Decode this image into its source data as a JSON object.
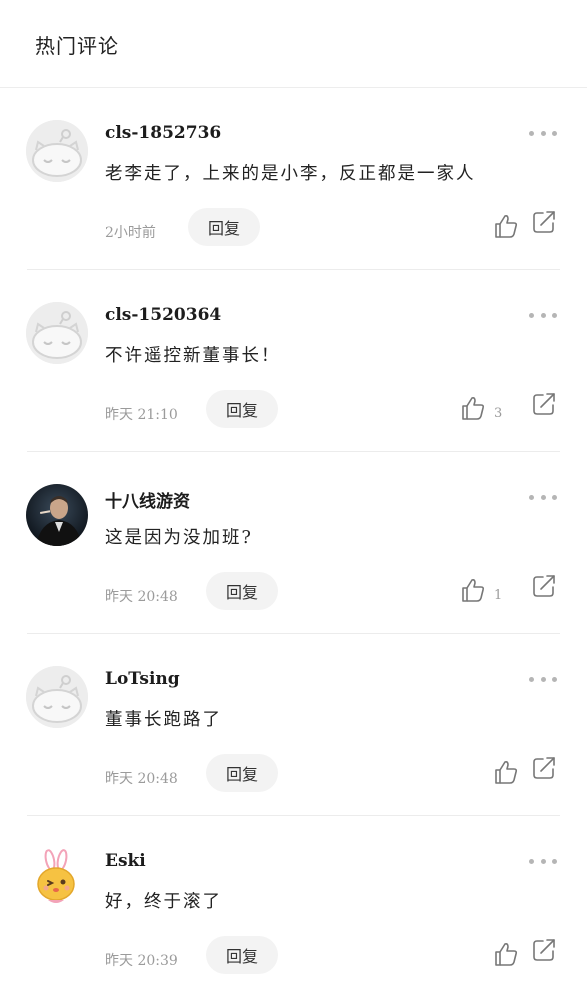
{
  "header": {
    "title": "热门评论"
  },
  "comments": [
    {
      "username": "cls-1852736",
      "text": "老李走了，上来的是小李，反正都是一家人",
      "time": "2小时前",
      "reply_label": "回复",
      "likes": "",
      "avatar": "default-robot-avatar"
    },
    {
      "username": "cls-1520364",
      "text": "不许遥控新董事长！",
      "time": "昨天 21:10",
      "reply_label": "回复",
      "likes": "3",
      "avatar": "default-robot-avatar"
    },
    {
      "username": "十八线游资",
      "text": "这是因为没加班?",
      "time": "昨天 20:48",
      "reply_label": "回复",
      "likes": "1",
      "avatar": "dark-portrait-avatar"
    },
    {
      "username": "LoTsing",
      "text": "董事长跑路了",
      "time": "昨天 20:48",
      "reply_label": "回复",
      "likes": "",
      "avatar": "default-robot-avatar"
    },
    {
      "username": "Eski",
      "text": "好，终于滚了",
      "time": "昨天 20:39",
      "reply_label": "回复",
      "likes": "",
      "avatar": "cartoon-bunny-avatar"
    }
  ],
  "icons": {
    "more": "more-dots-icon",
    "like": "thumbs-up-icon",
    "share": "share-icon"
  },
  "colors": {
    "muted_text": "#9b9b9b",
    "reply_bg": "#f3f3f3",
    "divider": "#ececec"
  }
}
